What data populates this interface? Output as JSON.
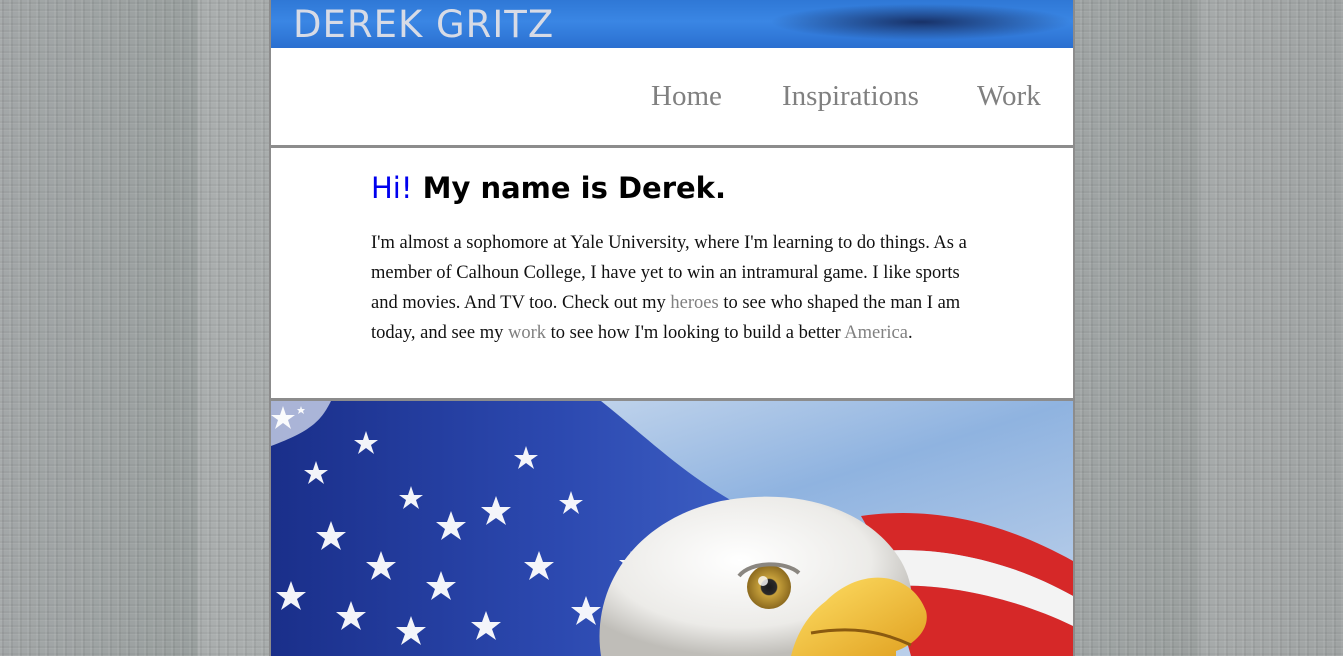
{
  "banner": {
    "title": "DEREK GRITZ"
  },
  "nav": {
    "items": [
      {
        "label": "Home"
      },
      {
        "label": "Inspirations"
      },
      {
        "label": "Work"
      }
    ]
  },
  "intro": {
    "greeting_hi": "Hi!",
    "greeting_rest": " My name is Derek.",
    "bio_1": "I'm almost a sophomore at Yale University, where I'm learning to do things. As a member of Calhoun College, I have yet to win an intramural game. I like sports and movies. And TV too. Check out my ",
    "link_heroes": "heroes",
    "bio_2": " to see who shaped the man I am today, and see my ",
    "link_work": "work",
    "bio_3": " to see how I'm looking to build a better ",
    "link_america": "America",
    "bio_4": "."
  },
  "colors": {
    "banner_blue": "#2f78d6",
    "link_gray": "#808080",
    "hi_blue": "#0000ee"
  },
  "hero_image": {
    "subject": "bald-eagle-and-american-flag"
  }
}
